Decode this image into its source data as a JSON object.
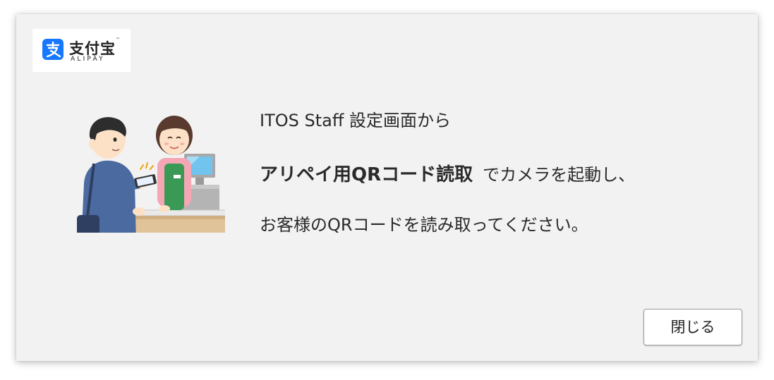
{
  "logo": {
    "brand_cn": "支付宝",
    "brand_en": "ALIPAY",
    "trademark": "™",
    "icon": "alipay-logo-icon"
  },
  "illustration": {
    "icon": "qr-payment-counter-illustration"
  },
  "message": {
    "line1": "ITOS Staff 設定画面から",
    "line2_bold": "アリペイ用QRコード読取",
    "line2_rest": "でカメラを起動し、",
    "line3": "お客様のQRコードを読み取ってください。"
  },
  "buttons": {
    "close_label": "閉じる"
  },
  "colors": {
    "alipay_blue": "#1677ff",
    "dialog_bg": "#f2f2f2"
  }
}
